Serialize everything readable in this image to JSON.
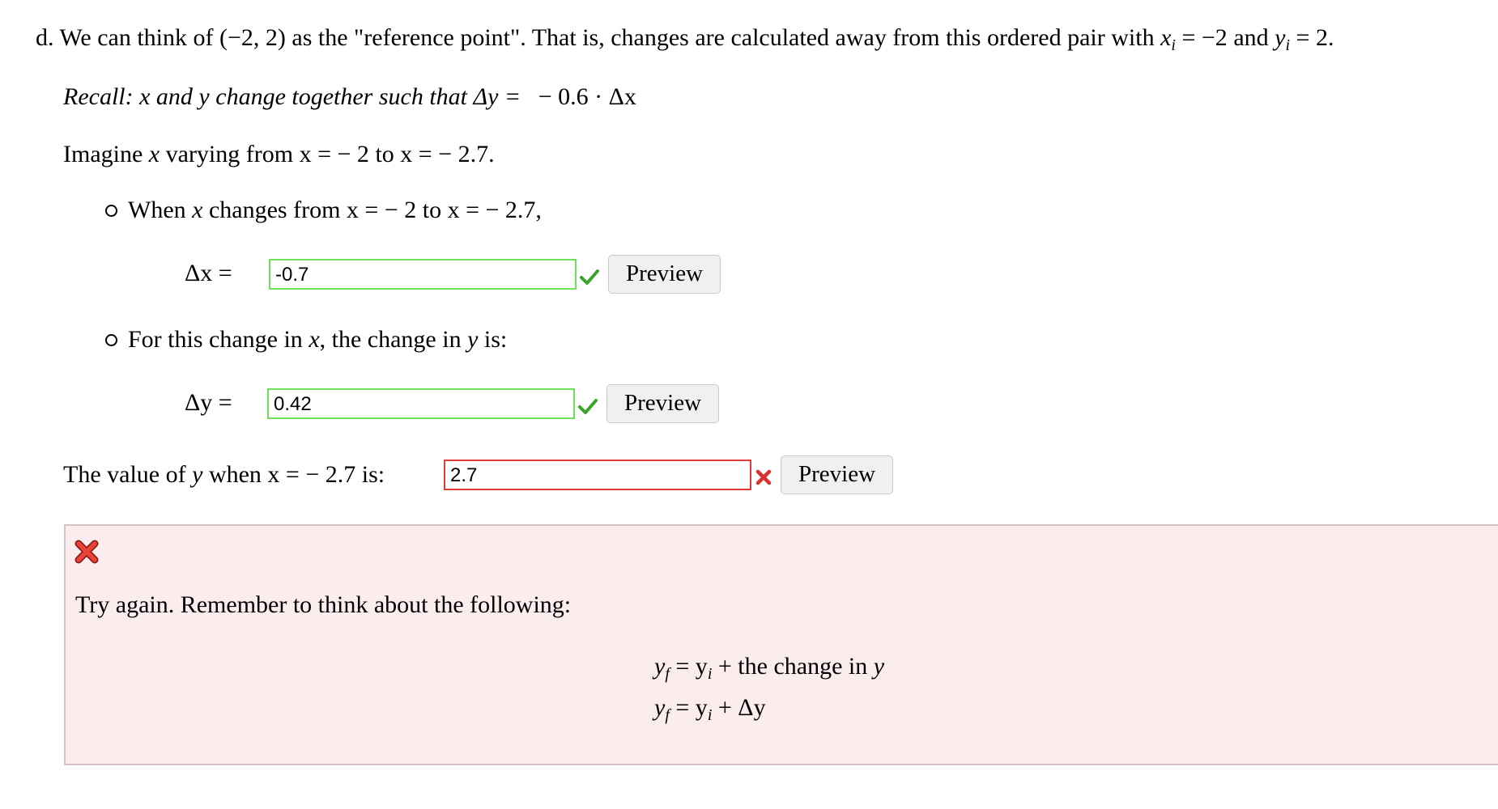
{
  "question": {
    "part": "d.",
    "intro_pre": "We can think of",
    "point": "(−2, 2)",
    "intro_mid": "as the \"reference point\". That is, changes are calculated away from this ordered pair with",
    "xi_eq": "= −2",
    "and": "and",
    "yi_eq": "= 2."
  },
  "recall": {
    "text": "Recall: x and y change together such that Δy =",
    "expr": "− 0.6 · Δx"
  },
  "imagine": {
    "pre": "Imagine",
    "var": "x",
    "mid": "varying from",
    "from_expr": "x =   − 2",
    "to": "to",
    "to_expr": "x =   − 2.7."
  },
  "bullet1": {
    "pre": "When",
    "var": "x",
    "mid": "changes from",
    "from_expr": "x =   − 2",
    "to": "to",
    "to_expr": "x =   − 2.7,"
  },
  "delta_x": {
    "label": "Δx =",
    "value": "-0.7",
    "status": "correct",
    "preview": "Preview"
  },
  "bullet2": {
    "pre": "For this change in",
    "var1": "x",
    "mid": ", the change in",
    "var2": "y",
    "post": "is:"
  },
  "delta_y": {
    "label": "Δy =",
    "value": "0.42",
    "status": "correct",
    "preview": "Preview"
  },
  "final": {
    "pre": "The value of",
    "var": "y",
    "mid": "when",
    "expr": "x =   − 2.7 is:",
    "value": "2.7",
    "status": "incorrect",
    "preview": "Preview"
  },
  "feedback": {
    "message": "Try again. Remember to think about the following:",
    "eq1_rhs": "= y",
    "eq1_tail": "+ the change in",
    "eq1_var": "y",
    "eq2_rhs": "= y",
    "eq2_tail": "+ Δy"
  },
  "colors": {
    "correct_border": "#70e05a",
    "incorrect_border": "#e03a3a",
    "feedback_bg": "#fbecee",
    "check_green": "#3aa32a",
    "cross_red": "#d9312b"
  },
  "icons": {
    "correct": "check-icon",
    "incorrect": "cross-icon"
  }
}
